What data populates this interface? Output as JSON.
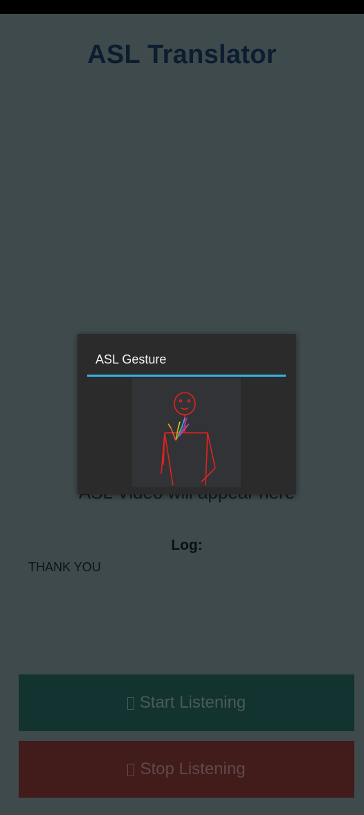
{
  "app": {
    "title": "ASL Translator"
  },
  "main": {
    "video_placeholder": "ASL Video will appear here",
    "log_label": "Log:",
    "log_text": "THANK YOU"
  },
  "buttons": {
    "start_label": "Start Listening",
    "stop_label": "Stop Listening"
  },
  "dialog": {
    "title": "ASL Gesture",
    "accent_color": "#33b5e5",
    "image_icon": "stick-figure-pose-icon"
  },
  "colors": {
    "start_button": "#12332f",
    "stop_button": "#421b1b",
    "pose_body": "#e3221f"
  }
}
